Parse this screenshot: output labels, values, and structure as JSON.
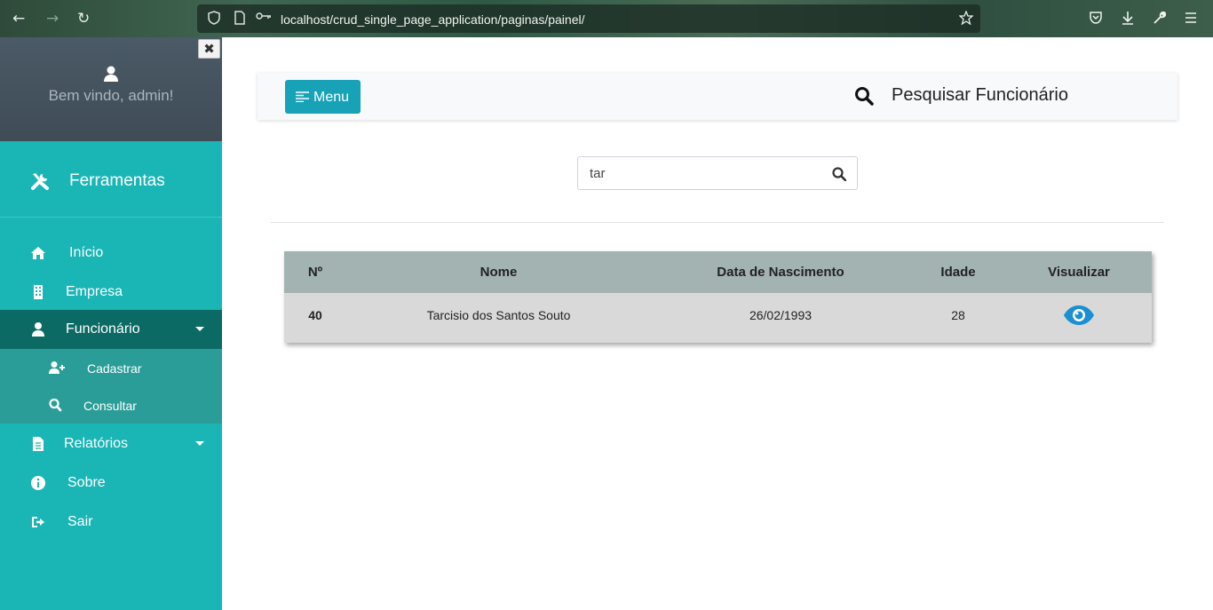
{
  "browser": {
    "url": "localhost/crud_single_page_application/paginas/painel/",
    "back_icon": "arrow-left-icon",
    "forward_icon": "arrow-right-icon",
    "reload_icon": "reload-icon"
  },
  "sidebar": {
    "close_label": "✖",
    "welcome": "Bem vindo, admin!",
    "tools_label": "Ferramentas",
    "items": [
      {
        "label": "Início",
        "icon": "home-icon"
      },
      {
        "label": "Empresa",
        "icon": "building-icon"
      },
      {
        "label": "Funcionário",
        "icon": "user-icon",
        "active": true
      },
      {
        "label": "Relatórios",
        "icon": "file-icon"
      },
      {
        "label": "Sobre",
        "icon": "info-icon"
      },
      {
        "label": "Sair",
        "icon": "sign-out-icon"
      }
    ],
    "submenu": [
      {
        "label": "Cadastrar",
        "icon": "user-plus-icon"
      },
      {
        "label": "Consultar",
        "icon": "search-icon"
      }
    ]
  },
  "topbar": {
    "menu_label": "Menu",
    "title": "Pesquisar Funcionário"
  },
  "search": {
    "value": "tar"
  },
  "table": {
    "headers": [
      "Nº",
      "Nome",
      "Data de Nascimento",
      "Idade",
      "Visualizar"
    ],
    "rows": [
      {
        "num": "40",
        "nome": "Tarcisio dos Santos Souto",
        "nascimento": "26/02/1993",
        "idade": "28"
      }
    ]
  },
  "colors": {
    "sidebar": "#1ab5b5",
    "sidebar_active": "#0b6b64",
    "primary_button": "#17a2b8",
    "eye_icon": "#1a8fd1"
  }
}
